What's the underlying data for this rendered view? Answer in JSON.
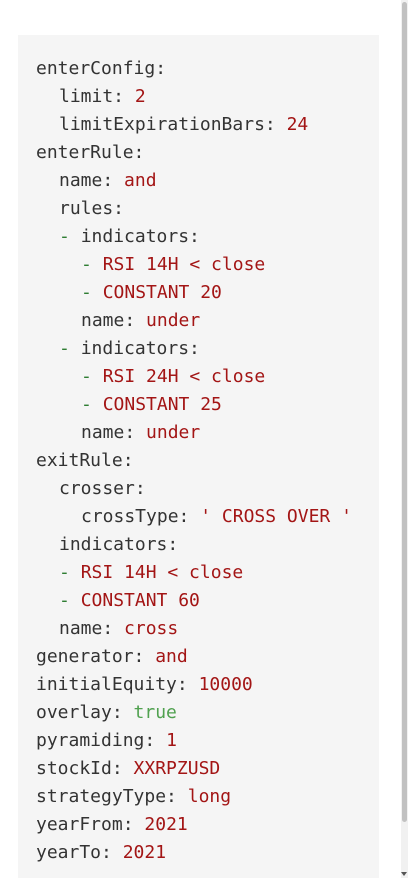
{
  "yaml": {
    "enterConfig": {
      "key": "enterConfig:",
      "limit_key": "limit:",
      "limit_val": "2",
      "limitExpirationBars_key": "limitExpirationBars:",
      "limitExpirationBars_val": "24"
    },
    "enterRule": {
      "key": "enterRule:",
      "name_key": "name:",
      "name_val": "and",
      "rules_key": "rules:",
      "dash": "-",
      "group1": {
        "indicators_key": "indicators:",
        "item1": "RSI 14H < close",
        "item2": "CONSTANT 20",
        "name_key": "name:",
        "name_val": "under"
      },
      "group2": {
        "indicators_key": "indicators:",
        "item1": "RSI 24H < close",
        "item2": "CONSTANT 25",
        "name_key": "name:",
        "name_val": "under"
      }
    },
    "exitRule": {
      "key": "exitRule:",
      "crosser_key": "crosser:",
      "crossType_key": "crossType:",
      "crossType_val": "' CROSS OVER '",
      "indicators_key": "indicators:",
      "item1": "RSI 14H < close",
      "item2": "CONSTANT 60",
      "name_key": "name:",
      "name_val": "cross"
    },
    "generator": {
      "key": "generator:",
      "val": "and"
    },
    "initialEquity": {
      "key": "initialEquity:",
      "val": "10000"
    },
    "overlay": {
      "key": "overlay:",
      "val": "true"
    },
    "pyramiding": {
      "key": "pyramiding:",
      "val": "1"
    },
    "stockId": {
      "key": "stockId:",
      "val": "XXRPZUSD"
    },
    "strategyType": {
      "key": "strategyType:",
      "val": "long"
    },
    "yearFrom": {
      "key": "yearFrom:",
      "val": "2021"
    },
    "yearTo": {
      "key": "yearTo:",
      "val": "2021"
    }
  },
  "colors": {
    "key": "#333333",
    "string": "#a31515",
    "boolean": "#50a14f",
    "dash": "#2e7d32",
    "code_background": "#f5f5f5"
  }
}
